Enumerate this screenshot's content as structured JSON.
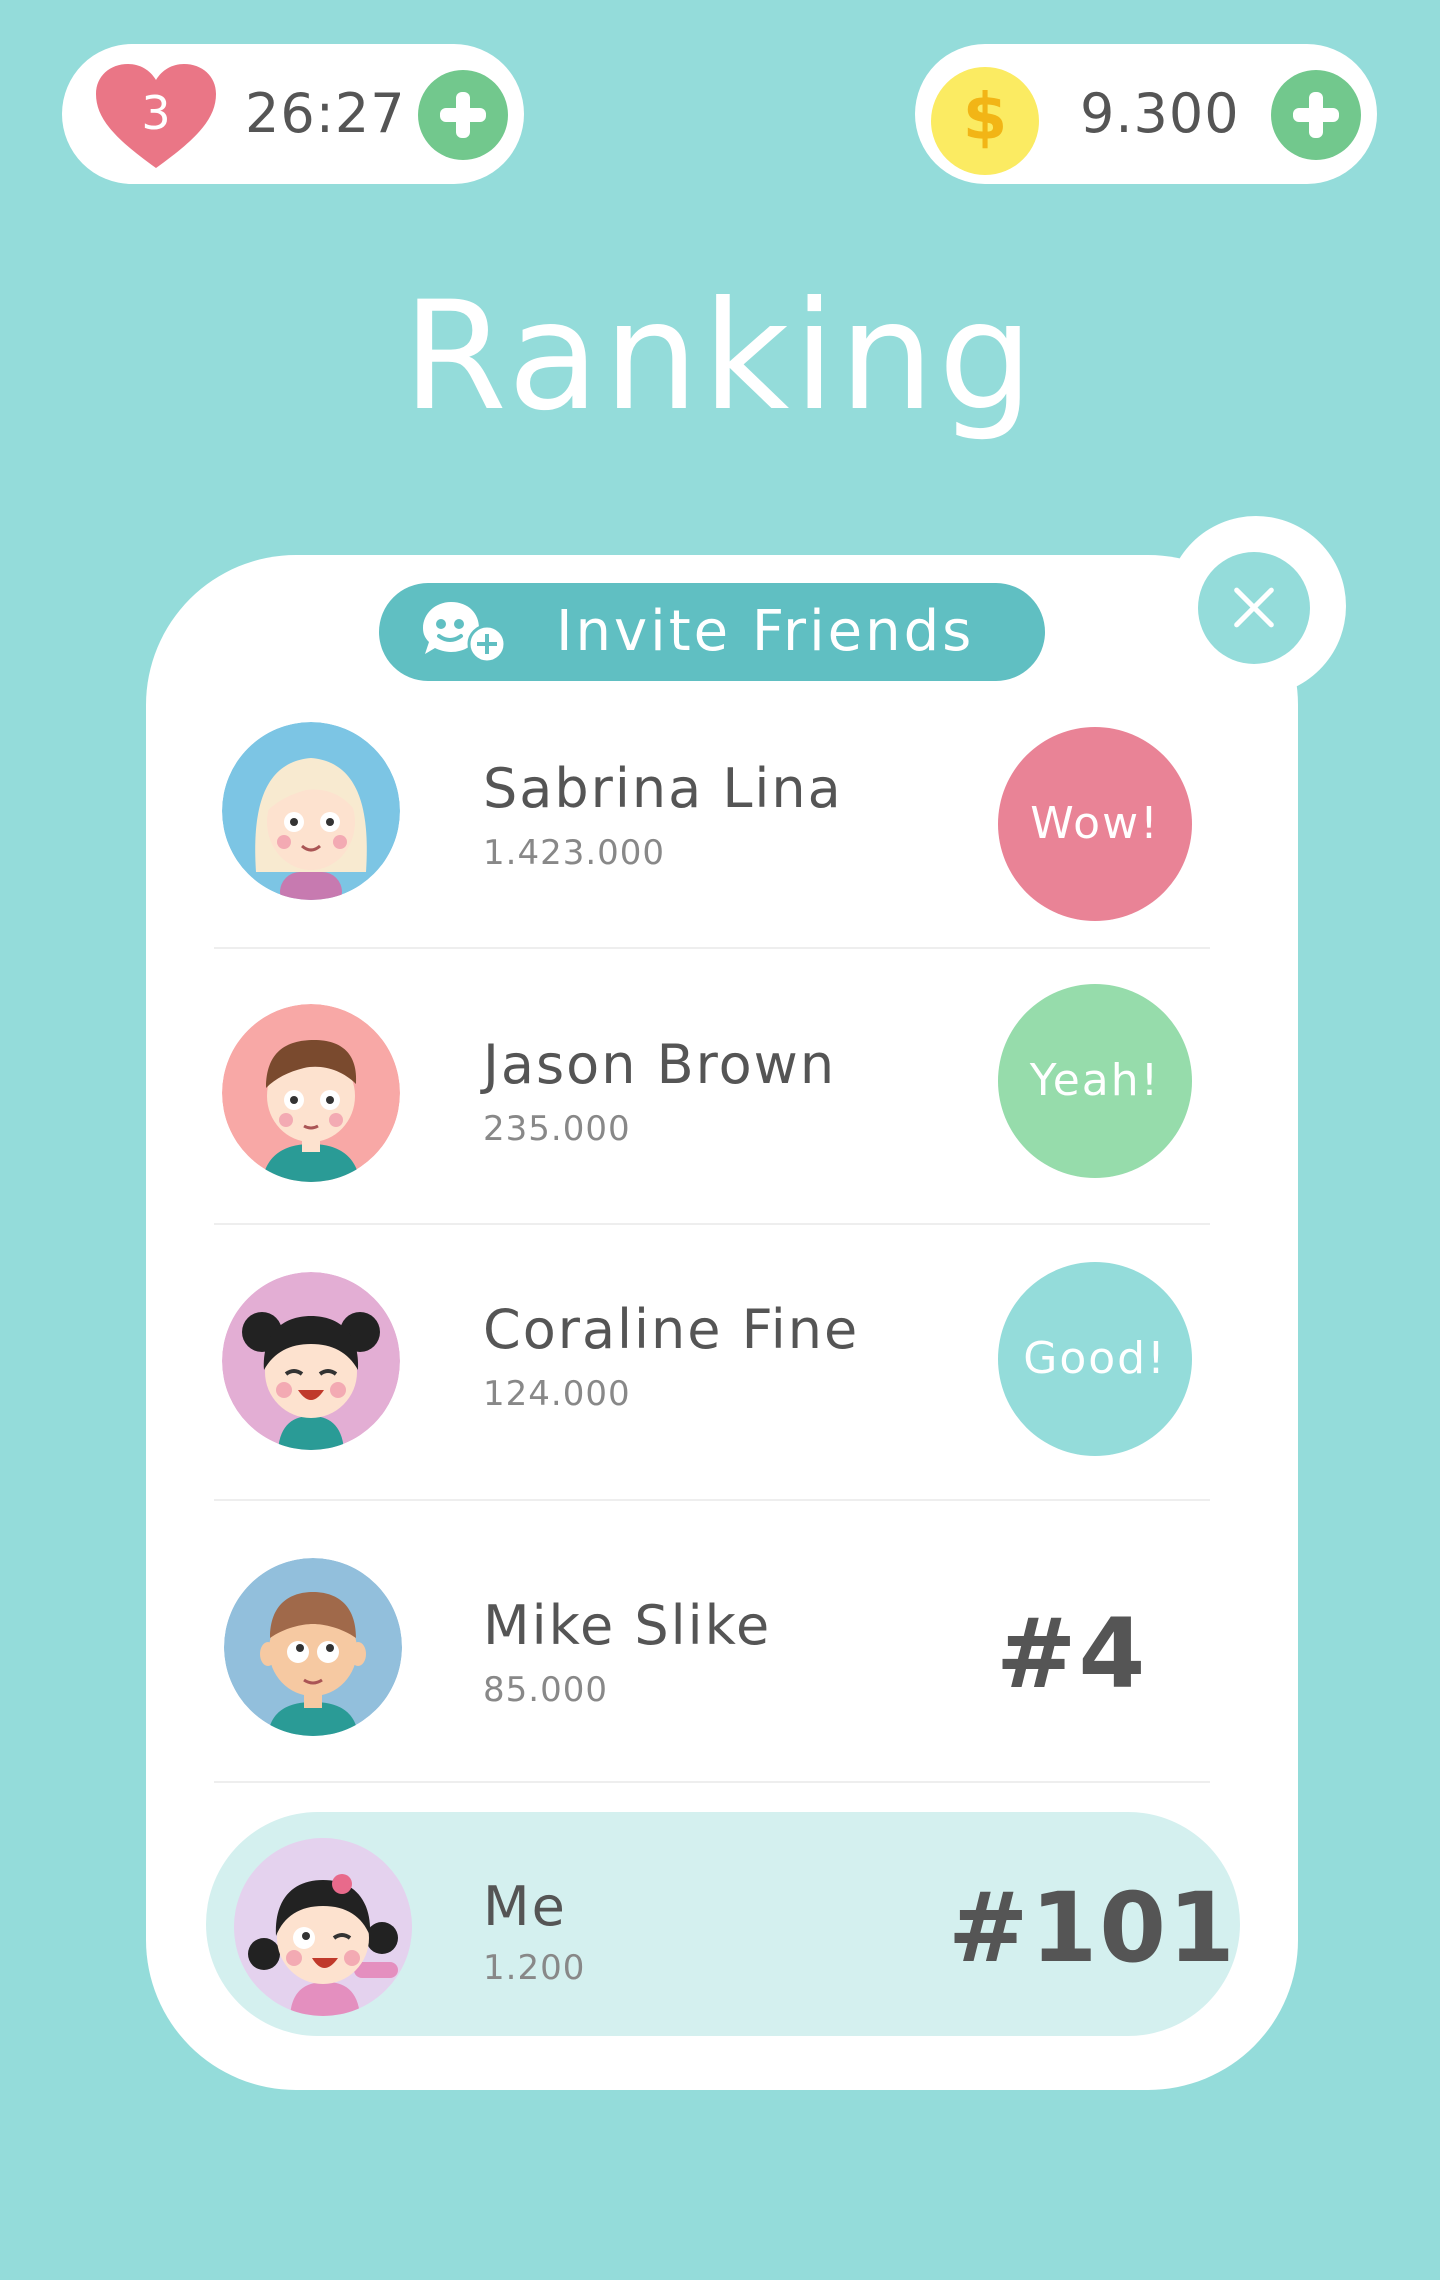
{
  "status": {
    "lives": "3",
    "timer": "26:27",
    "coins": "9.300",
    "coin_symbol": "$"
  },
  "title": "Ranking",
  "invite": {
    "label": "Invite Friends"
  },
  "players": [
    {
      "name": "Sabrina Lina",
      "score": "1.423.000",
      "badge": "Wow!"
    },
    {
      "name": "Jason Brown",
      "score": "235.000",
      "badge": "Yeah!"
    },
    {
      "name": "Coraline Fine",
      "score": "124.000",
      "badge": "Good!"
    },
    {
      "name": "Mike Slike",
      "score": "85.000",
      "rank": "#4"
    }
  ],
  "me": {
    "name": "Me",
    "score": "1.200",
    "rank": "#101"
  },
  "colors": {
    "background": "#94dcda",
    "accent": "#60bfc2",
    "heart": "#ea7686",
    "plus": "#72c88d",
    "coin": "#fbeb62",
    "badge_wow": "#e98396",
    "badge_yeah": "#96dcab",
    "badge_good": "#94dcda",
    "me_row": "#d4f0ef"
  },
  "icons": [
    "heart-icon",
    "coin-icon",
    "plus-icon",
    "close-icon",
    "invite-friends-icon"
  ]
}
